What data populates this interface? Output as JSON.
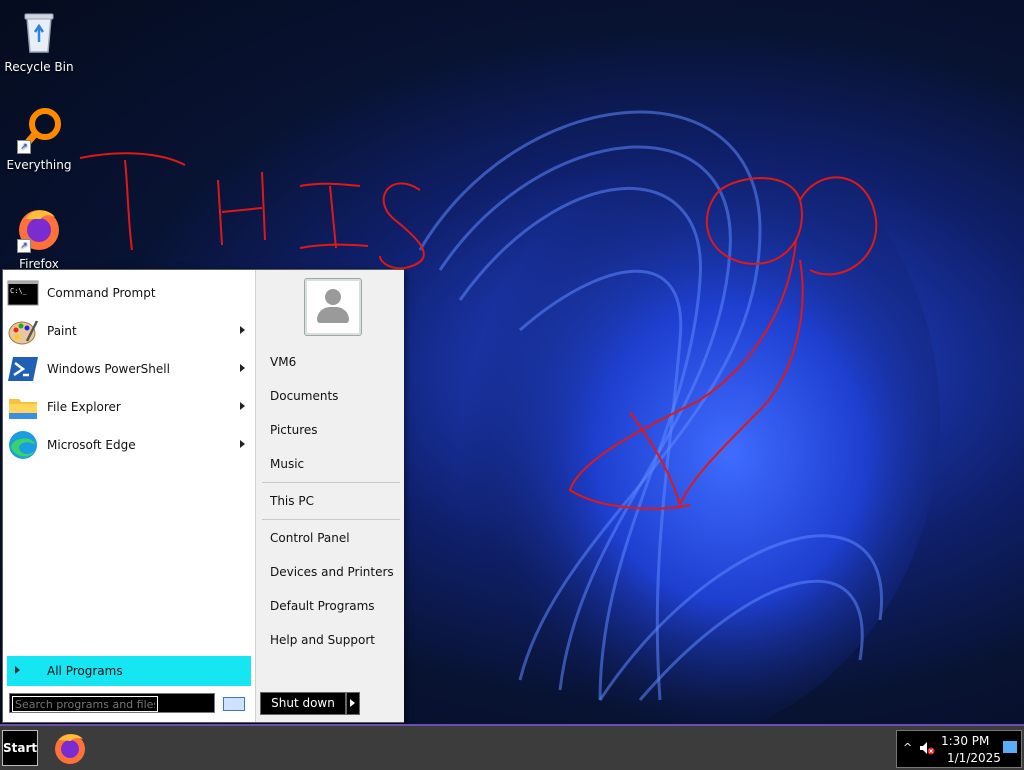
{
  "desktop": {
    "icons": [
      {
        "label": "Recycle Bin",
        "icon": "recycle-bin-icon"
      },
      {
        "label": "Everything",
        "icon": "everything-search-icon"
      },
      {
        "label": "Firefox",
        "icon": "firefox-icon"
      }
    ],
    "annotation": "THIS"
  },
  "start_menu": {
    "programs": [
      {
        "label": "Command Prompt",
        "icon": "command-prompt-icon",
        "has_submenu": false
      },
      {
        "label": "Paint",
        "icon": "paint-icon",
        "has_submenu": true
      },
      {
        "label": "Windows PowerShell",
        "icon": "powershell-icon",
        "has_submenu": true
      },
      {
        "label": "File Explorer",
        "icon": "file-explorer-icon",
        "has_submenu": true
      },
      {
        "label": "Microsoft Edge",
        "icon": "edge-icon",
        "has_submenu": true
      }
    ],
    "all_programs_label": "All Programs",
    "search_placeholder": "Search programs and files",
    "user_name": "VM6",
    "right_items_group1": [
      "Documents",
      "Pictures",
      "Music"
    ],
    "right_items_group2": [
      "This PC"
    ],
    "right_items_group3": [
      "Control Panel",
      "Devices and Printers",
      "Default Programs",
      "Help and Support"
    ],
    "shutdown_label": "Shut down"
  },
  "taskbar": {
    "start_label": "Start",
    "pinned": [
      {
        "icon": "firefox-icon"
      }
    ],
    "tray": {
      "time": "1:30 PM",
      "date": "1/1/2025",
      "up_arrow": "^",
      "volume_muted": true
    }
  },
  "colors": {
    "accent_highlight": "#16e6f2",
    "taskbar_border": "#6a4fb0",
    "annotation_red": "#e01818"
  }
}
